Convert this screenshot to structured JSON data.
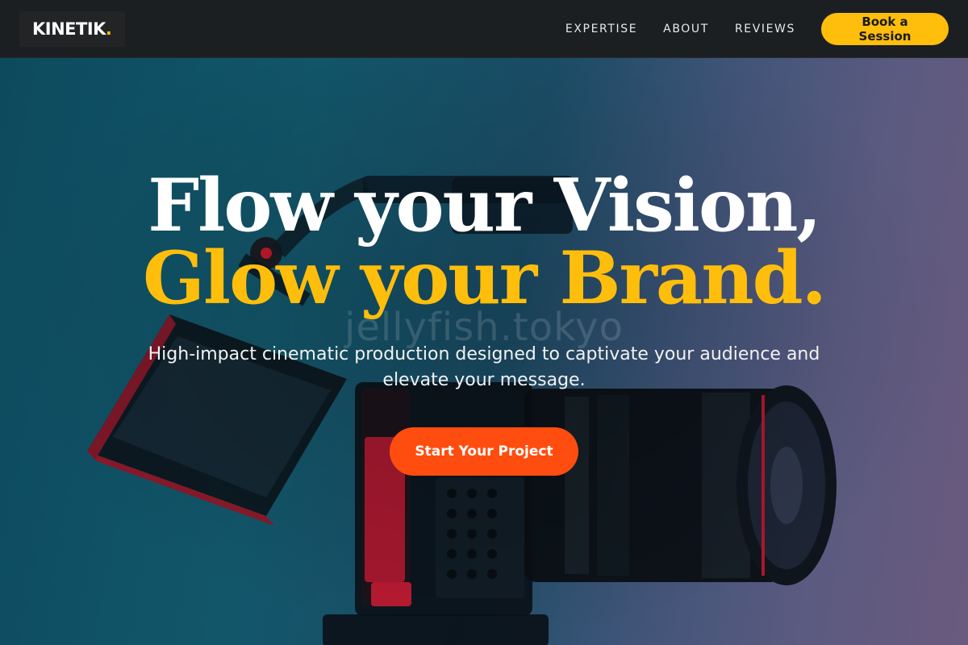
{
  "nav": {
    "logo_text": "KINETIK",
    "logo_dot": ".",
    "links": [
      "EXPERTISE",
      "ABOUT",
      "REVIEWS"
    ],
    "cta_label": "Book a Session"
  },
  "hero": {
    "headline_line1": "Flow your Vision,",
    "headline_line2": "Glow your Brand.",
    "watermark": "jellyfish.tokyo",
    "subtext": "High-impact cinematic production designed to captivate your audience and elevate your message.",
    "cta_label": "Start Your Project",
    "background_image": "camera-rig-photo"
  },
  "colors": {
    "accent_yellow": "#ffbe0b",
    "accent_orange": "#ff4d0f",
    "nav_bg": "#1c1f21"
  }
}
